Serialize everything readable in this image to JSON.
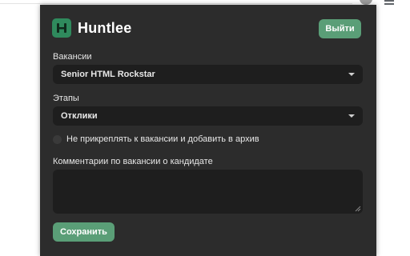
{
  "header": {
    "logo_icon": "huntlee-logo-icon",
    "brand_name": "Huntlee",
    "logout_label": "Выйти"
  },
  "vacancy": {
    "label": "Вакансии",
    "selected": "Senior HTML Rockstar"
  },
  "stage": {
    "label": "Этапы",
    "selected": "Отклики"
  },
  "archive_option": {
    "label": "Не прикреплять к вакансии и добавить в архив",
    "checked": false
  },
  "comment": {
    "label": "Комментарии по вакансии о кандидате",
    "value": ""
  },
  "actions": {
    "save_label": "Сохранить"
  },
  "colors": {
    "popup_background": "#2c2c2c",
    "field_background": "#1e1e1e",
    "accent_green": "#5a9e77",
    "logo_green": "#2f8a5d"
  }
}
